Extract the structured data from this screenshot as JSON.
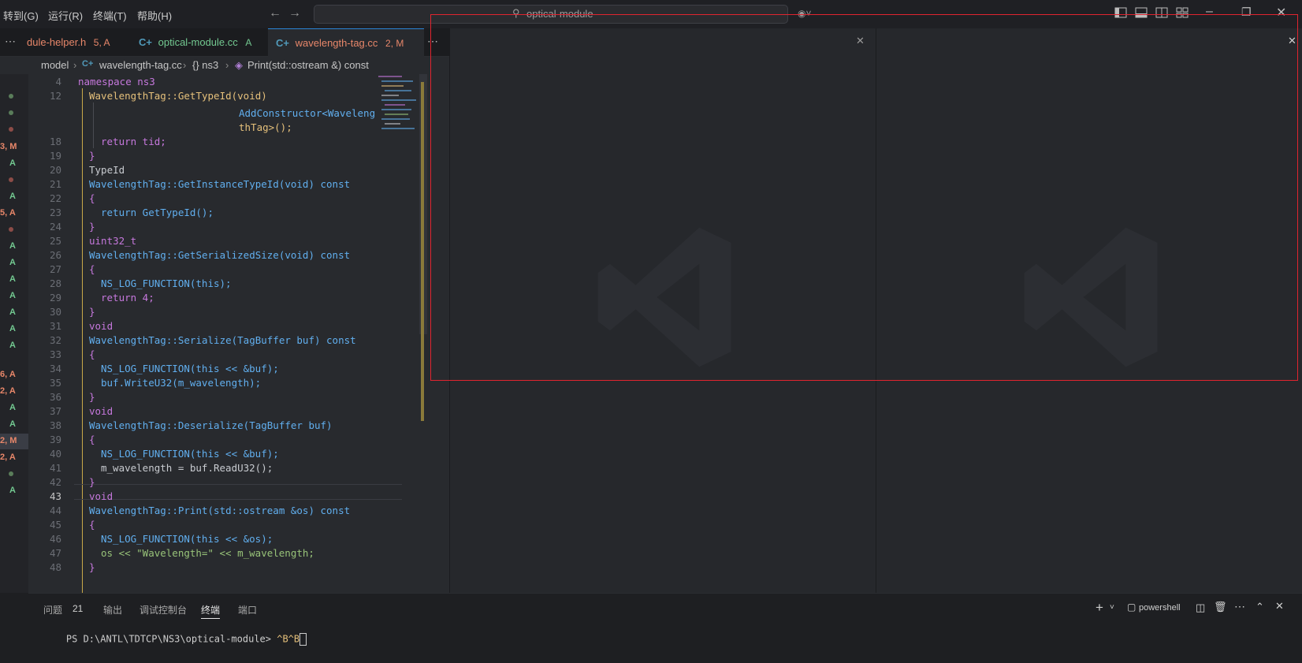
{
  "menu": [
    "转到(G)",
    "运行(R)",
    "终端(T)",
    "帮助(H)"
  ],
  "search": {
    "text": "optical-module"
  },
  "tabs": [
    {
      "label": "dule-helper.h",
      "badge": "5, A",
      "color": "#e8876a"
    },
    {
      "label": "optical-module.cc",
      "badge": "A",
      "color": "#73c991"
    },
    {
      "label": "wavelength-tag.cc",
      "badge": "2, M",
      "color": "#e8876a"
    }
  ],
  "breadcrumb": {
    "folder": "model",
    "file": "wavelength-tag.cc",
    "ns": "{} ns3",
    "symbol": "Print(std::ostream &) const"
  },
  "scm_marks": [
    "",
    "",
    "",
    "3, M",
    "A",
    "",
    "A",
    "5, A",
    "",
    "A",
    "A",
    "A",
    "A",
    "A",
    "A",
    "A",
    "6, A",
    "2, A",
    "A",
    "A",
    "2, M",
    "2, A",
    "",
    "A"
  ],
  "line_numbers": [
    "4",
    "12",
    "",
    "",
    "18",
    "19",
    "20",
    "21",
    "22",
    "23",
    "24",
    "25",
    "26",
    "27",
    "28",
    "29",
    "30",
    "31",
    "32",
    "33",
    "34",
    "35",
    "36",
    "37",
    "38",
    "39",
    "40",
    "41",
    "42",
    "43",
    "44",
    "45",
    "46",
    "47",
    "48"
  ],
  "code": {
    "l4": "namespace ns3",
    "l12": "WavelengthTag::GetTypeId(void)",
    "addctor_a": "AddConstructor<Waveleng",
    "addctor_b": "thTag>();",
    "l18": "return tid;",
    "l19": "}",
    "l20": "TypeId",
    "l21": "WavelengthTag::GetInstanceTypeId(void) const",
    "l22": "{",
    "l23": "return GetTypeId();",
    "l24": "}",
    "l25": "uint32_t",
    "l26": "WavelengthTag::GetSerializedSize(void) const",
    "l27": "{",
    "l28": "NS_LOG_FUNCTION(this);",
    "l29": "return 4;",
    "l30": "}",
    "l31": "void",
    "l32": "WavelengthTag::Serialize(TagBuffer buf) const",
    "l33": "{",
    "l34": "NS_LOG_FUNCTION(this << &buf);",
    "l35": "buf.WriteU32(m_wavelength);",
    "l36": "}",
    "l37": "void",
    "l38": "WavelengthTag::Deserialize(TagBuffer buf)",
    "l39": "{",
    "l40": "NS_LOG_FUNCTION(this << &buf);",
    "l41": "m_wavelength = buf.ReadU32();",
    "l42": "}",
    "l43": "void",
    "l44": "WavelengthTag::Print(std::ostream &os) const",
    "l45": "{",
    "l46": "NS_LOG_FUNCTION(this << &os);",
    "l47": "os << \"Wavelength=\" << m_wavelength;",
    "l48": "}"
  },
  "panel": {
    "tabs": [
      "问题",
      "输出",
      "调试控制台",
      "终端",
      "端口"
    ],
    "problems_count": "21",
    "shell": "powershell",
    "prompt": "PS D:\\ANTL\\TDTCP\\NS3\\optical-module>",
    "typed": "^B^B"
  },
  "colors": {
    "accent": "#2a84d6",
    "modified": "#e8876a",
    "added": "#73c991",
    "highlight_box": "#e0242f"
  }
}
